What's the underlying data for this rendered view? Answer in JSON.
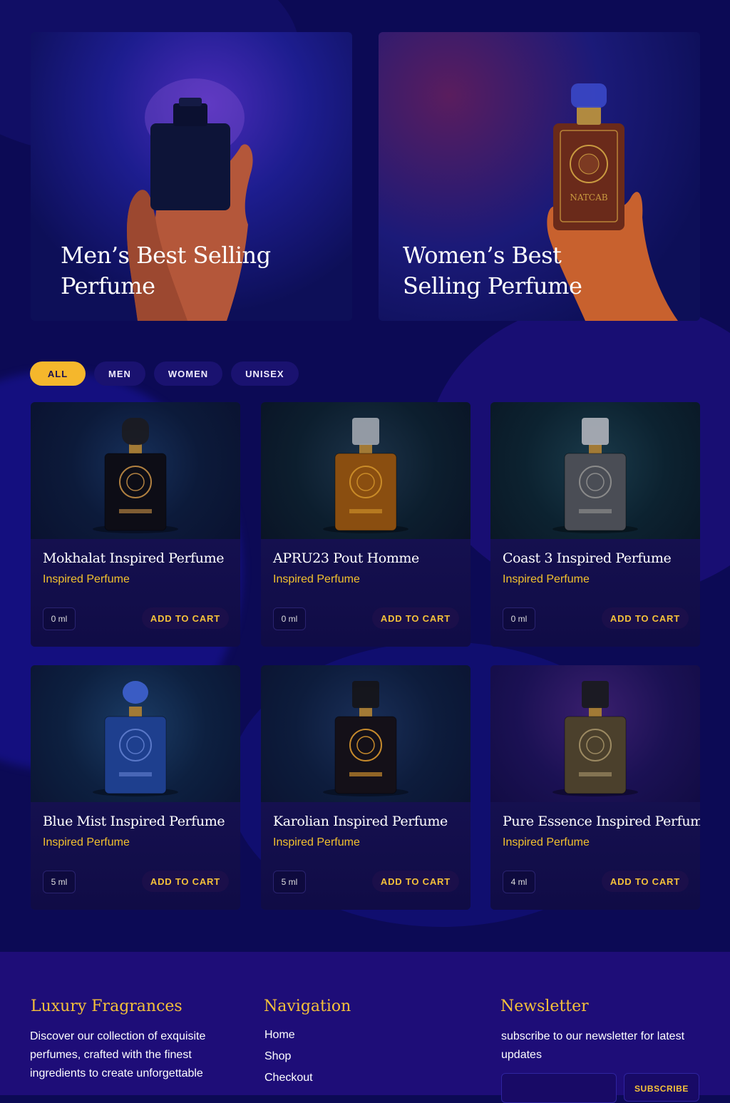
{
  "hero": [
    {
      "title": "Men’s Best Selling Perfume"
    },
    {
      "title": "Women’s Best Selling Perfume",
      "bottle_label": "NATCAB"
    }
  ],
  "filters": [
    {
      "label": "ALL",
      "active": true
    },
    {
      "label": "MEN",
      "active": false
    },
    {
      "label": "WOMEN",
      "active": false
    },
    {
      "label": "UNISEX",
      "active": false
    }
  ],
  "products": [
    {
      "name": "Mokhalat Inspired Perfume",
      "subtitle": "Inspired Perfume",
      "size": "0 ml",
      "cart": "ADD TO CART",
      "bottle": "black",
      "label_color": "#b08040"
    },
    {
      "name": "APRU23 Pout Homme",
      "subtitle": "Inspired Perfume",
      "size": "0 ml",
      "cart": "ADD TO CART",
      "bottle": "amber",
      "label_color": "#c98b28"
    },
    {
      "name": "Coast 3 Inspired Perfume",
      "subtitle": "Inspired Perfume",
      "size": "0 ml",
      "cart": "ADD TO CART",
      "bottle": "silver",
      "label_color": "#8a8a8a"
    },
    {
      "name": "Blue Mist Inspired Perfume",
      "subtitle": "Inspired Perfume",
      "size": "5 ml",
      "cart": "ADD TO CART",
      "bottle": "blue",
      "label_color": "#5a78c8"
    },
    {
      "name": "Karolian Inspired Perfume",
      "subtitle": "Inspired Perfume",
      "size": "5 ml",
      "cart": "ADD TO CART",
      "bottle": "black-gold",
      "label_color": "#c68a2c"
    },
    {
      "name": "Pure Essence Inspired Perfume",
      "subtitle": "Inspired Perfume",
      "size": "4 ml",
      "cart": "ADD TO CART",
      "bottle": "smoke",
      "label_color": "#9c8a62"
    }
  ],
  "footer": {
    "brand": {
      "title": "Luxury Fragrances",
      "text": "Discover our collection of exquisite perfumes, crafted with the finest ingredients to create unforgettable"
    },
    "navigation": {
      "title": "Navigation",
      "items": [
        "Home",
        "Shop",
        "Checkout"
      ]
    },
    "newsletter": {
      "title": "Newsletter",
      "text": "subscribe to our newsletter for latest updates",
      "button": "SUBSCRIBE",
      "placeholder": ""
    }
  },
  "colors": {
    "accent": "#f5b72c",
    "background": "#0c0a55",
    "footer": "#1e0d78"
  }
}
